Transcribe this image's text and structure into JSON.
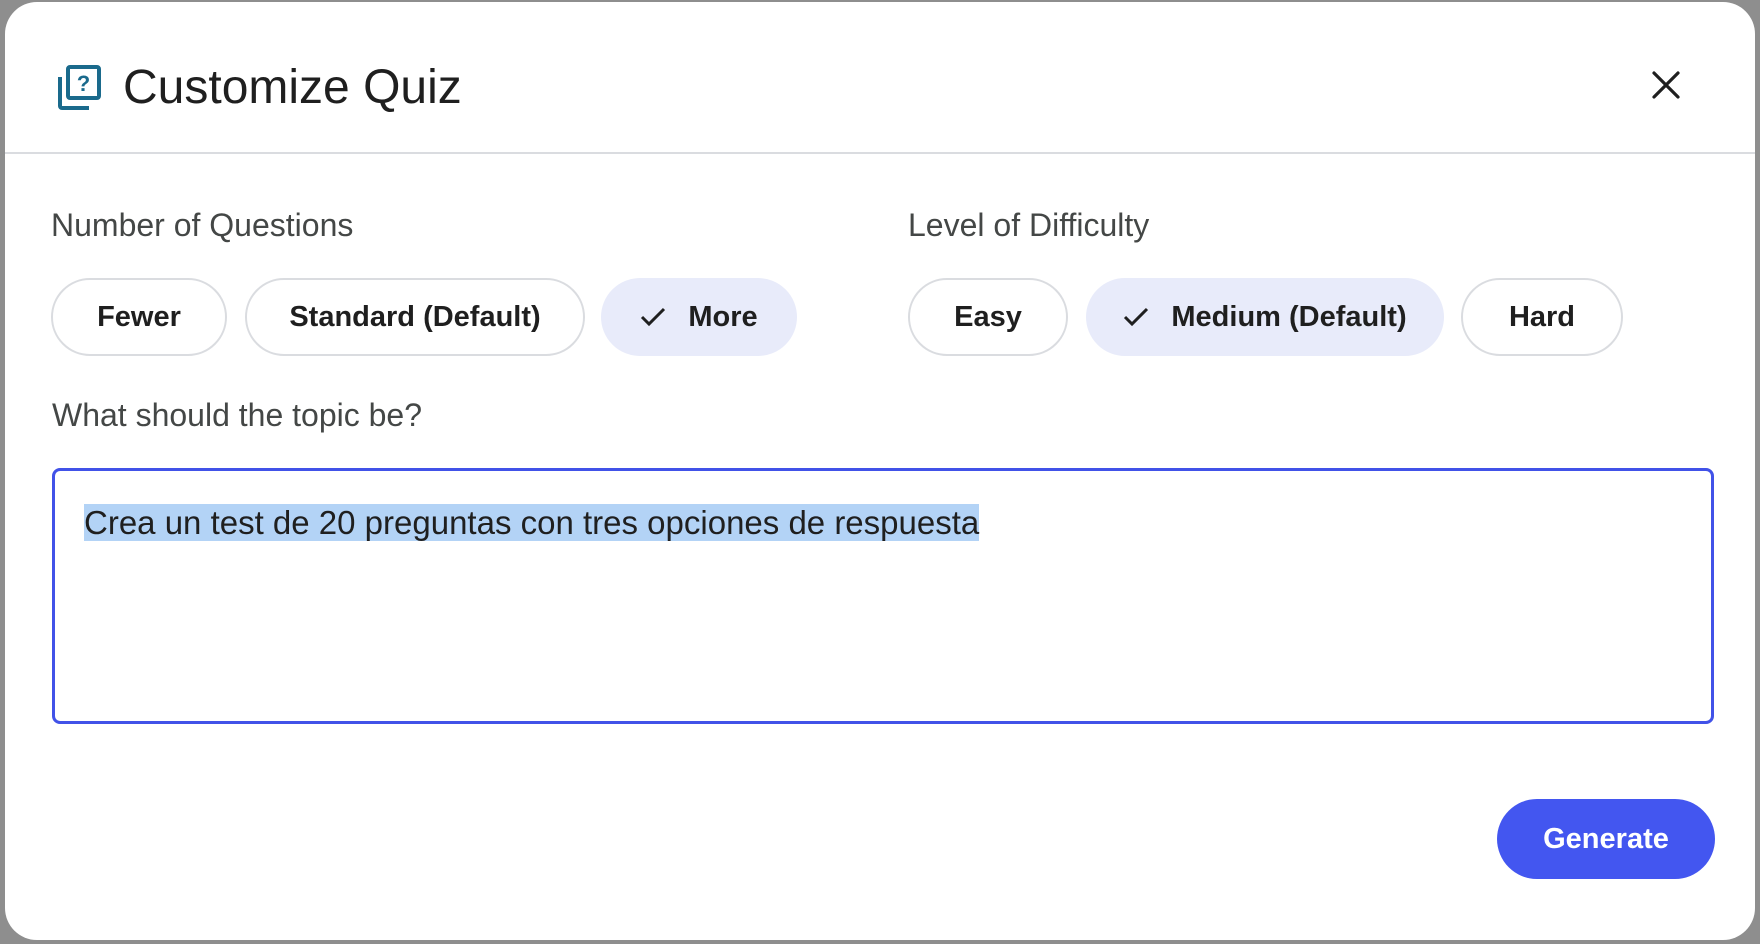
{
  "dialog": {
    "title": "Customize Quiz",
    "title_icon": "quiz-icon",
    "close_icon": "close-icon"
  },
  "questions": {
    "label": "Number of Questions",
    "options": [
      {
        "label": "Fewer",
        "selected": false
      },
      {
        "label": "Standard (Default)",
        "selected": false
      },
      {
        "label": "More",
        "selected": true
      }
    ]
  },
  "difficulty": {
    "label": "Level of Difficulty",
    "options": [
      {
        "label": "Easy",
        "selected": false
      },
      {
        "label": "Medium (Default)",
        "selected": true
      },
      {
        "label": "Hard",
        "selected": false
      }
    ]
  },
  "topic": {
    "label": "What should the topic be?",
    "value": "Crea un test de 20 preguntas con tres opciones de respuesta"
  },
  "actions": {
    "generate_label": "Generate"
  },
  "colors": {
    "accent": "#4356f0",
    "selected_chip_bg": "#e8ebfa",
    "icon_teal": "#1a6a8c",
    "text_selection": "#b3d3f6"
  }
}
